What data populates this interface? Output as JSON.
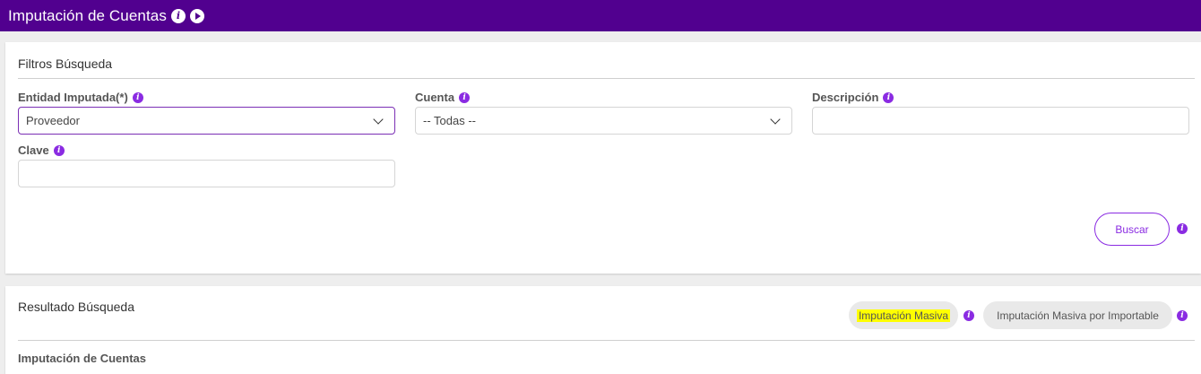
{
  "header": {
    "title": "Imputación de Cuentas"
  },
  "filters": {
    "section_title": "Filtros Búsqueda",
    "entidad": {
      "label": "Entidad Imputada(*)",
      "value": "Proveedor"
    },
    "cuenta": {
      "label": "Cuenta",
      "value": "-- Todas --"
    },
    "descripcion": {
      "label": "Descripción",
      "value": ""
    },
    "clave": {
      "label": "Clave",
      "value": ""
    },
    "search_button": "Buscar"
  },
  "results": {
    "section_title": "Resultado Búsqueda",
    "btn_masiva": "Imputación Masiva",
    "btn_masiva_importable": "Imputación Masiva por Importable",
    "subsection_title": "Imputación de Cuentas"
  },
  "colors": {
    "header_bg": "#51008f",
    "accent": "#8a2be2",
    "highlight": "#ffff00"
  },
  "icons": [
    "info-icon",
    "play-icon",
    "chevron-down-icon"
  ]
}
